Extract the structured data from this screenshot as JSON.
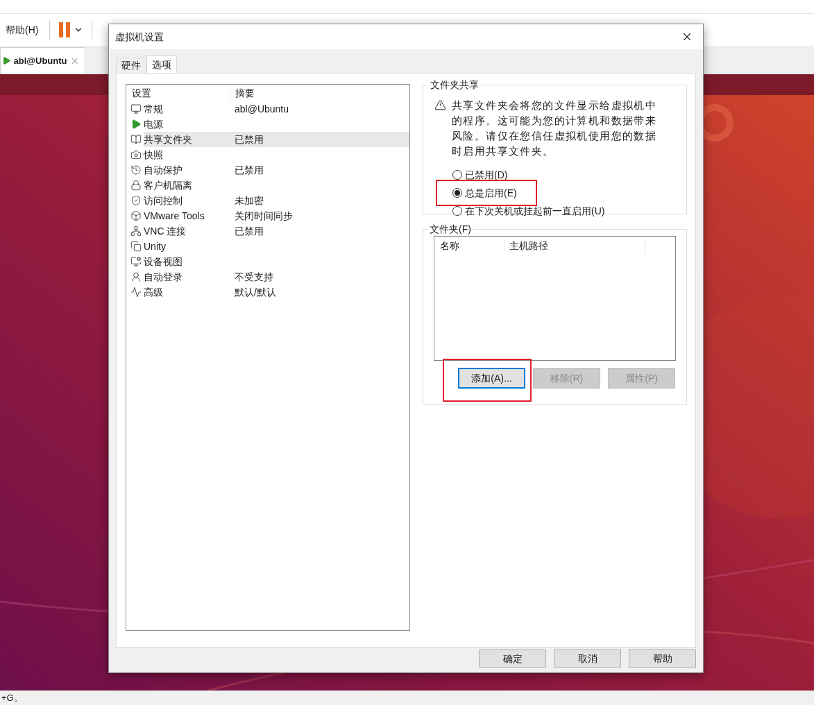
{
  "menu": {
    "help": "帮助(H)"
  },
  "vm_tab": {
    "title": "abl@Ubuntu",
    "selected": true
  },
  "dialog": {
    "title": "虚拟机设置",
    "tabs": [
      {
        "label": "硬件",
        "selected": false
      },
      {
        "label": "选项",
        "selected": true
      }
    ],
    "settings_list": {
      "columns": [
        "设置",
        "摘要"
      ],
      "rows": [
        {
          "name": "常规",
          "summary": "abl@Ubuntu",
          "selected": false
        },
        {
          "name": "电源",
          "selected": false
        },
        {
          "name": "共享文件夹",
          "summary": "已禁用",
          "selected": true
        },
        {
          "name": "快照",
          "selected": false
        },
        {
          "name": "自动保护",
          "summary": "已禁用",
          "selected": false
        },
        {
          "name": "客户机隔离",
          "selected": false
        },
        {
          "name": "访问控制",
          "summary": "未加密",
          "selected": false
        },
        {
          "name": "VMware Tools",
          "summary": "关闭时间同步",
          "selected": false
        },
        {
          "name": "VNC 连接",
          "summary": "已禁用",
          "selected": false
        },
        {
          "name": "Unity",
          "selected": false
        },
        {
          "name": "设备视图",
          "selected": false
        },
        {
          "name": "自动登录",
          "summary": "不受支持",
          "selected": false
        },
        {
          "name": "高级",
          "summary": "默认/默认",
          "selected": false
        }
      ]
    },
    "folder_sharing": {
      "title": "文件夹共享",
      "warning": "共享文件夹会将您的文件显示给虚拟机中的程序。这可能为您的计算机和数据带来风险。请仅在您信任虚拟机使用您的数据时启用共享文件夹。",
      "options": [
        {
          "label": "已禁用(D)",
          "selected": false,
          "highlighted": false
        },
        {
          "label": "总是启用(E)",
          "selected": true,
          "highlighted": true
        },
        {
          "label": "在下次关机或挂起前一直启用(U)",
          "selected": false,
          "highlighted": false
        }
      ]
    },
    "folders": {
      "title": "文件夹(F)",
      "columns": [
        "名称",
        "主机路径"
      ],
      "buttons": [
        {
          "label": "添加(A)...",
          "disabled": false,
          "focused": true,
          "highlighted": true
        },
        {
          "label": "移除(R)",
          "disabled": true,
          "focused": false,
          "highlighted": false
        },
        {
          "label": "属性(P)",
          "disabled": true,
          "focused": false,
          "highlighted": false
        }
      ]
    },
    "footer_buttons": [
      "确定",
      "取消",
      "帮助"
    ]
  },
  "status_bar": {
    "text": "+G。"
  }
}
